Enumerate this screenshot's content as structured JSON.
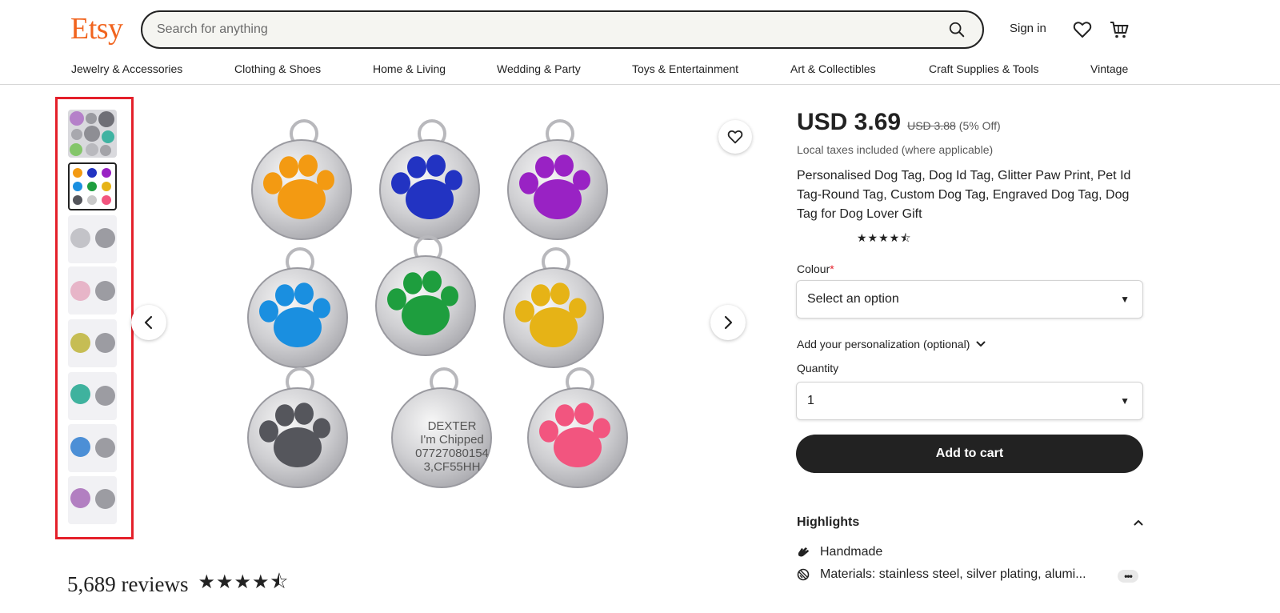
{
  "header": {
    "logo": "Etsy",
    "search_placeholder": "Search for anything",
    "sign_in": "Sign in"
  },
  "nav": {
    "items": [
      {
        "label": "Jewelry & Accessories"
      },
      {
        "label": "Clothing & Shoes"
      },
      {
        "label": "Home & Living"
      },
      {
        "label": "Wedding & Party"
      },
      {
        "label": "Toys & Entertainment"
      },
      {
        "label": "Art & Collectibles"
      },
      {
        "label": "Craft Supplies & Tools"
      },
      {
        "label": "Vintage"
      }
    ]
  },
  "gallery": {
    "thumbnail_count": 8,
    "selected_index": 1,
    "tag_engraving": [
      "DEXTER",
      "I'm Chipped",
      "07727080154",
      "3,CF55HH"
    ],
    "tag_colors": [
      "#f39a12",
      "#2233c2",
      "#9922c4",
      "#1a8fe0",
      "#1e9e3e",
      "#e6b316",
      "#55565c",
      "#c9c9c9",
      "#f2557f"
    ]
  },
  "reviews": {
    "count_label": "5,689 reviews",
    "stars": "★★★★⯪"
  },
  "product": {
    "price": "USD 3.69",
    "old_price": "USD 3.88",
    "discount": "(5% Off)",
    "tax_note": "Local taxes included (where applicable)",
    "title": "Personalised Dog Tag, Dog Id Tag, Glitter Paw Print, Pet Id Tag-Round Tag, Custom Dog Tag, Engraved Dog Tag, Dog Tag for Dog Lover Gift",
    "rating_stars": "★★★★⯪",
    "colour_label": "Colour",
    "required_mark": "*",
    "colour_value": "Select an option",
    "personalization_label": "Add your personalization (optional)",
    "quantity_label": "Quantity",
    "quantity_value": "1",
    "add_to_cart": "Add to cart",
    "highlights_title": "Highlights",
    "highlights": [
      {
        "text": "Handmade",
        "icon": "hand-icon"
      },
      {
        "text": "Materials: stainless steel, silver plating, alumi...",
        "icon": "materials-icon"
      }
    ],
    "more_label": "•••"
  },
  "colors": {
    "brand": "#f1641e",
    "highlight_box": "#e4202a"
  }
}
